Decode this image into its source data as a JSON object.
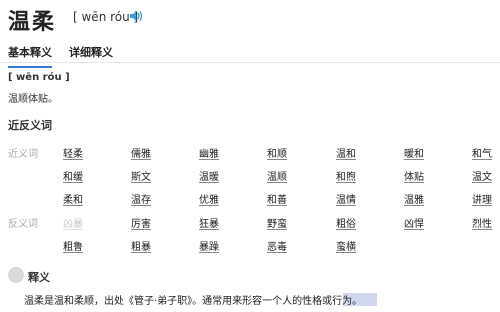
{
  "header": {
    "title": "温柔",
    "pinyin": "[ wēn róu ]",
    "icons": {
      "sound": "speaker-icon"
    }
  },
  "tabs": [
    {
      "label": "基本释义",
      "active": true
    },
    {
      "label": "详细释义",
      "active": false
    }
  ],
  "definition": {
    "pinyin": "[ wēn róu ]",
    "text": "温顺体贴。"
  },
  "synonyms_section": {
    "title": "近反义词",
    "synonyms_label": "近义词",
    "antonyms_label": "反义词",
    "synonyms": [
      [
        "轻柔",
        "儒雅",
        "幽雅",
        "和顺",
        "温和",
        "暖和",
        "和气"
      ],
      [
        "和缓",
        "斯文",
        "温暖",
        "温顺",
        "和煦",
        "体贴",
        "温文"
      ],
      [
        "柔和",
        "温存",
        "优雅",
        "和善",
        "温情",
        "温雅",
        "讲理"
      ]
    ],
    "antonyms": [
      [
        "凶暴",
        "厉害",
        "狂暴",
        "野蛮",
        "粗俗",
        "凶悍",
        "烈性"
      ],
      [
        "粗鲁",
        "粗暴",
        "暴躁",
        "恶毒",
        "蛮横"
      ]
    ]
  },
  "meaning_section": {
    "title": "释义",
    "text": "温柔是温和柔顺，出处《管子·弟子职》。通常用来形容一个人的性格或行为。"
  },
  "colors": {
    "accent": "#3a7bd5",
    "faded": "#c8c8c8",
    "highlight": "#cfd8ee"
  }
}
